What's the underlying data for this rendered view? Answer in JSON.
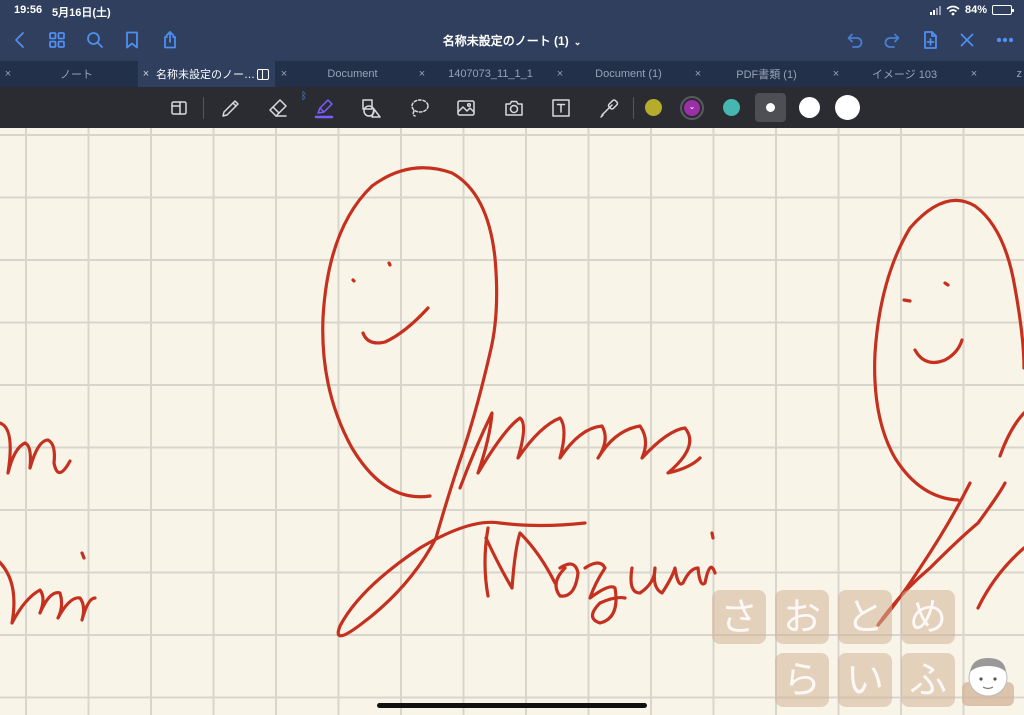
{
  "status": {
    "time": "19:56",
    "date": "5月16日(土)",
    "battery": "84%",
    "battery_level": 0.84
  },
  "nav": {
    "title": "名称未設定のノート (1)",
    "left_icons": [
      "back-icon",
      "grid-icon",
      "search-icon",
      "bookmark-icon",
      "share-icon"
    ],
    "right_icons": [
      "undo-icon",
      "redo-icon",
      "add-page-icon",
      "close-icon",
      "more-icon"
    ]
  },
  "tabs": [
    {
      "label": "ノート",
      "active": false
    },
    {
      "label": "名称未設定のノー…",
      "active": true
    },
    {
      "label": "Document",
      "active": false
    },
    {
      "label": "1407073_11_1_1",
      "active": false
    },
    {
      "label": "Document (1)",
      "active": false
    },
    {
      "label": "PDF書類 (1)",
      "active": false
    },
    {
      "label": "イメージ 103",
      "active": false
    },
    {
      "label": "z",
      "active": false
    }
  ],
  "tab_close_glyph": "×",
  "toolbar": {
    "tools": [
      "page-view-icon",
      "pen-icon",
      "eraser-icon",
      "highlighter-icon",
      "shapes-icon",
      "lasso-icon",
      "image-icon",
      "camera-icon",
      "text-icon",
      "laser-pointer-icon"
    ],
    "bluetooth_glyph": "ᛒ",
    "colors": [
      "#b5ab2c",
      "#9b2fa8",
      "#45b6b0"
    ],
    "selected_color": "#9b2fa8",
    "highlighter_color": "#7b5cff"
  },
  "watermark": {
    "row1": [
      "さ",
      "お",
      "と",
      "め"
    ],
    "row2": [
      "ら",
      "い",
      "ふ"
    ]
  },
  "ink_color": "#c5301f"
}
